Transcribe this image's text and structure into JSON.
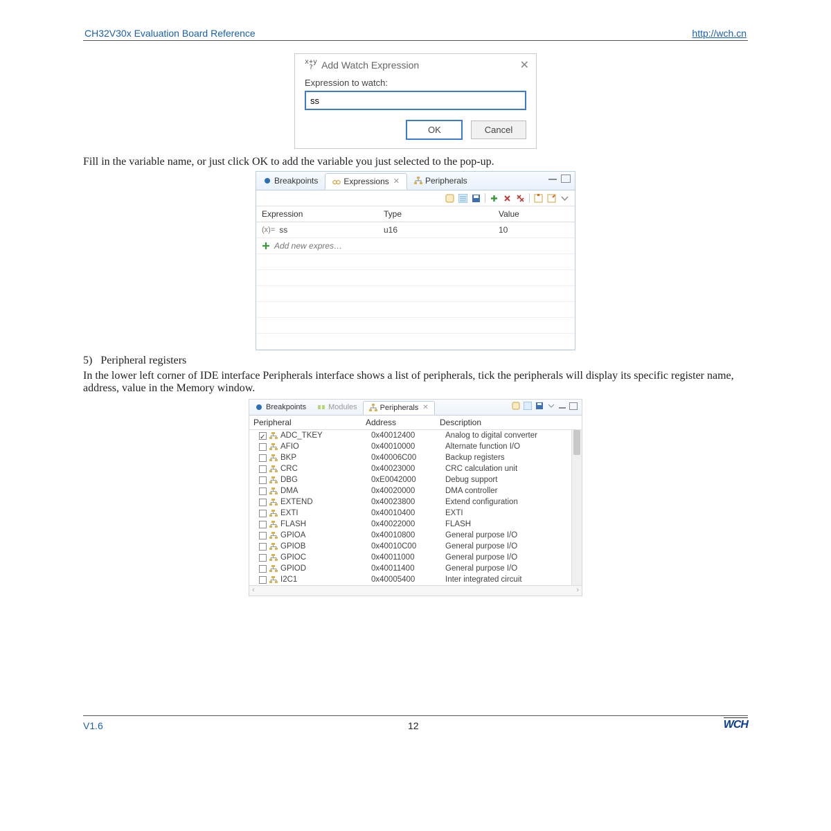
{
  "header": {
    "left": "CH32V30x Evaluation Board Reference",
    "right": "http://wch.cn"
  },
  "dialog": {
    "icon_label": "x+y?",
    "title": "Add Watch Expression",
    "label": "Expression to watch:",
    "value": "ss",
    "ok": "OK",
    "cancel": "Cancel"
  },
  "text1": "Fill in the variable name, or just click OK to add the variable you just selected to the pop-up.",
  "exp_panel": {
    "tabs": {
      "breakpoints": "Breakpoints",
      "expressions": "Expressions",
      "peripherals": "Peripherals",
      "close_glyph": "✕"
    },
    "cols": {
      "expression": "Expression",
      "type": "Type",
      "value": "Value"
    },
    "row1": {
      "prefix": "(x)=",
      "name": "ss",
      "type": "u16",
      "value": "10"
    },
    "addnew": "Add new expres…"
  },
  "section": {
    "num": "5)",
    "title": "Peripheral registers"
  },
  "text2": "In the lower left corner of IDE interface Peripherals interface shows a list of peripherals, tick the peripherals will display its specific register name, address, value in the Memory window.",
  "peri_panel": {
    "tabs": {
      "breakpoints": "Breakpoints",
      "modules": "Modules",
      "peripherals": "Peripherals",
      "close_glyph": "✕"
    },
    "cols": {
      "peripheral": "Peripheral",
      "address": "Address",
      "description": "Description"
    },
    "rows": [
      {
        "checked": true,
        "name": "ADC_TKEY",
        "addr": "0x40012400",
        "desc": "Analog to digital converter"
      },
      {
        "checked": false,
        "name": "AFIO",
        "addr": "0x40010000",
        "desc": "Alternate function I/O"
      },
      {
        "checked": false,
        "name": "BKP",
        "addr": "0x40006C00",
        "desc": "Backup registers"
      },
      {
        "checked": false,
        "name": "CRC",
        "addr": "0x40023000",
        "desc": "CRC calculation unit"
      },
      {
        "checked": false,
        "name": "DBG",
        "addr": "0xE0042000",
        "desc": "Debug support"
      },
      {
        "checked": false,
        "name": "DMA",
        "addr": "0x40020000",
        "desc": "DMA controller"
      },
      {
        "checked": false,
        "name": "EXTEND",
        "addr": "0x40023800",
        "desc": "Extend configuration"
      },
      {
        "checked": false,
        "name": "EXTI",
        "addr": "0x40010400",
        "desc": "EXTI"
      },
      {
        "checked": false,
        "name": "FLASH",
        "addr": "0x40022000",
        "desc": "FLASH"
      },
      {
        "checked": false,
        "name": "GPIOA",
        "addr": "0x40010800",
        "desc": "General purpose I/O"
      },
      {
        "checked": false,
        "name": "GPIOB",
        "addr": "0x40010C00",
        "desc": "General purpose I/O"
      },
      {
        "checked": false,
        "name": "GPIOC",
        "addr": "0x40011000",
        "desc": "General purpose I/O"
      },
      {
        "checked": false,
        "name": "GPIOD",
        "addr": "0x40011400",
        "desc": "General purpose I/O"
      },
      {
        "checked": false,
        "name": "I2C1",
        "addr": "0x40005400",
        "desc": "Inter integrated circuit"
      }
    ]
  },
  "footer": {
    "left": "V1.6",
    "center": "12",
    "logo": "WCH"
  }
}
